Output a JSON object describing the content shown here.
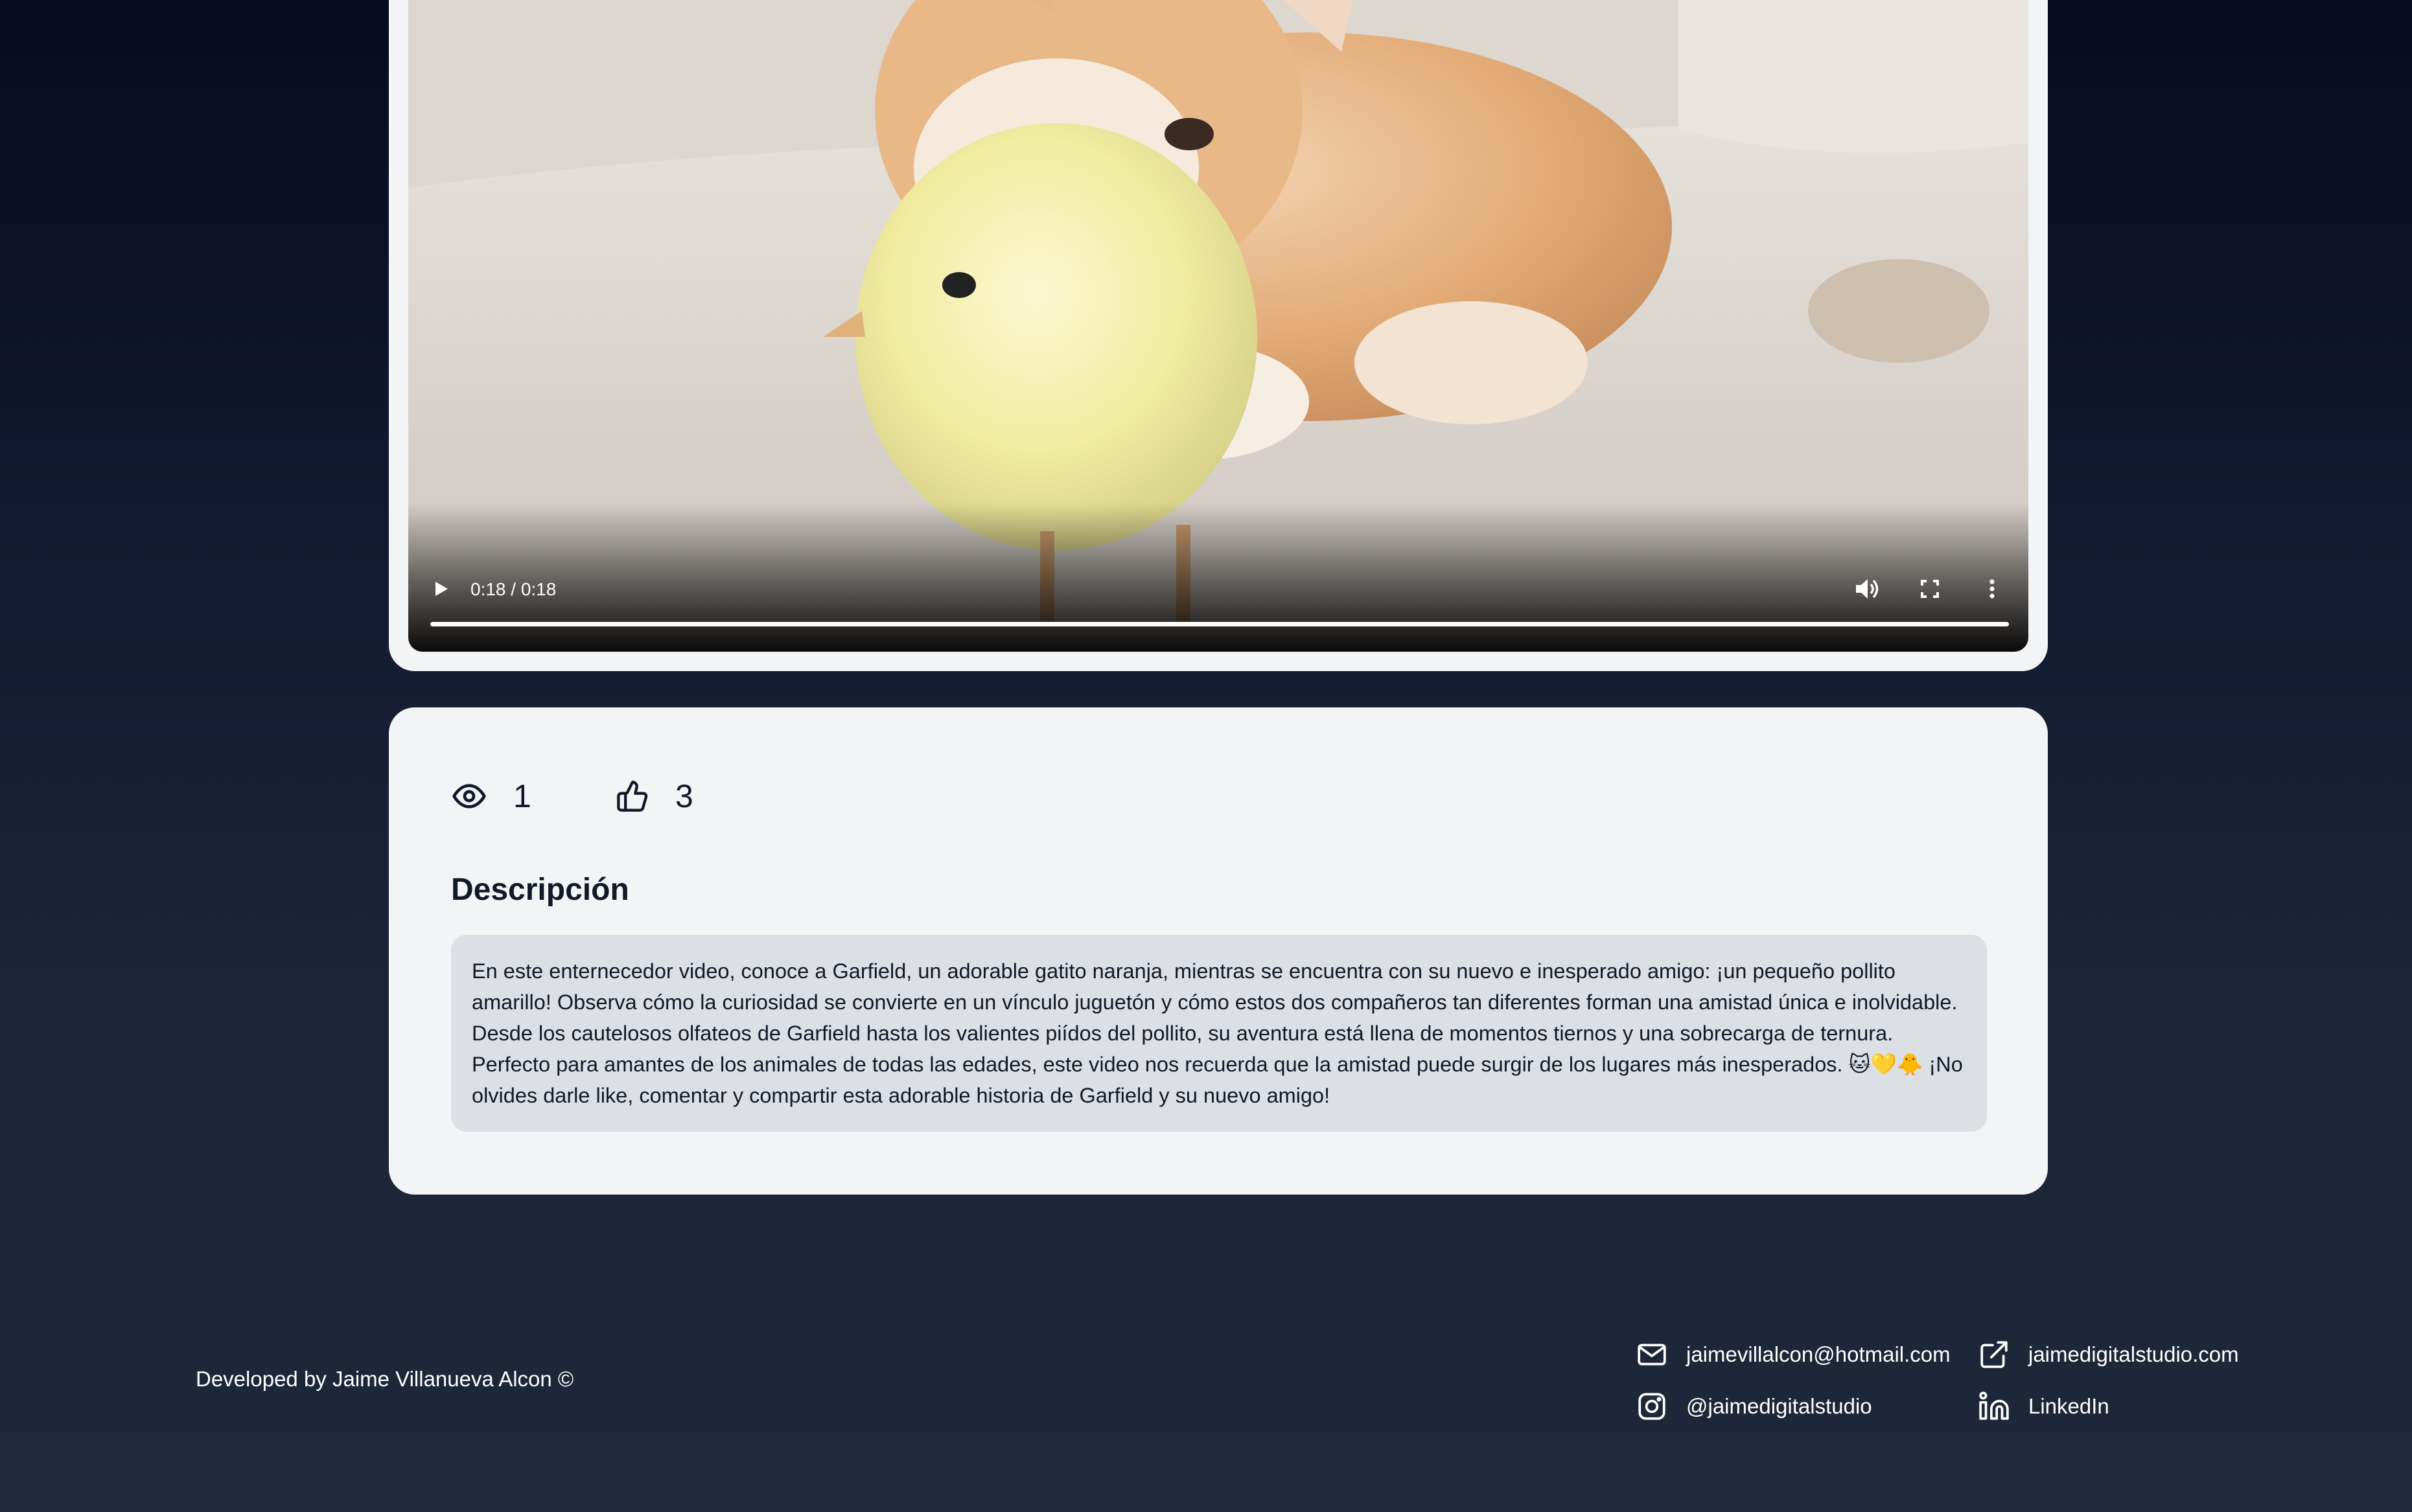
{
  "video": {
    "time_display": "0:18 / 0:18",
    "progress_fraction": 1.0,
    "icons": {
      "play": "play-icon",
      "volume": "volume-icon",
      "fullscreen": "fullscreen-icon",
      "more": "more-vertical-icon"
    }
  },
  "stats": {
    "views": "1",
    "likes": "3",
    "icons": {
      "views": "eye-icon",
      "likes": "thumbs-up-icon"
    }
  },
  "description": {
    "title": "Descripción",
    "text": "En este enternecedor video, conoce a Garfield, un adorable gatito naranja, mientras se encuentra con su nuevo e inesperado amigo: ¡un pequeño pollito amarillo! Observa cómo la curiosidad se convierte en un vínculo juguetón y cómo estos dos compañeros tan diferentes forman una amistad única e inolvidable. Desde los cautelosos olfateos de Garfield hasta los valientes piídos del pollito, su aventura está llena de momentos tiernos y una sobrecarga de ternura. Perfecto para amantes de los animales de todas las edades, este video nos recuerda que la amistad puede surgir de los lugares más inesperados. 🐱💛🐥 ¡No olvides darle like, comentar y compartir esta adorable historia de Garfield y su nuevo amigo!"
  },
  "footer": {
    "credit": "Developed by Jaime Villanueva Alcon ©",
    "contacts": {
      "email": "jaimevillalcon@hotmail.com",
      "website": "jaimedigitalstudio.com",
      "instagram": "@jaimedigitalstudio",
      "linkedin": "LinkedIn"
    }
  },
  "colors": {
    "card_bg": "#f3f4f6",
    "description_bg": "#dcdfe3",
    "page_bg_top": "#060b20",
    "page_bg_bottom": "#1e283a"
  }
}
